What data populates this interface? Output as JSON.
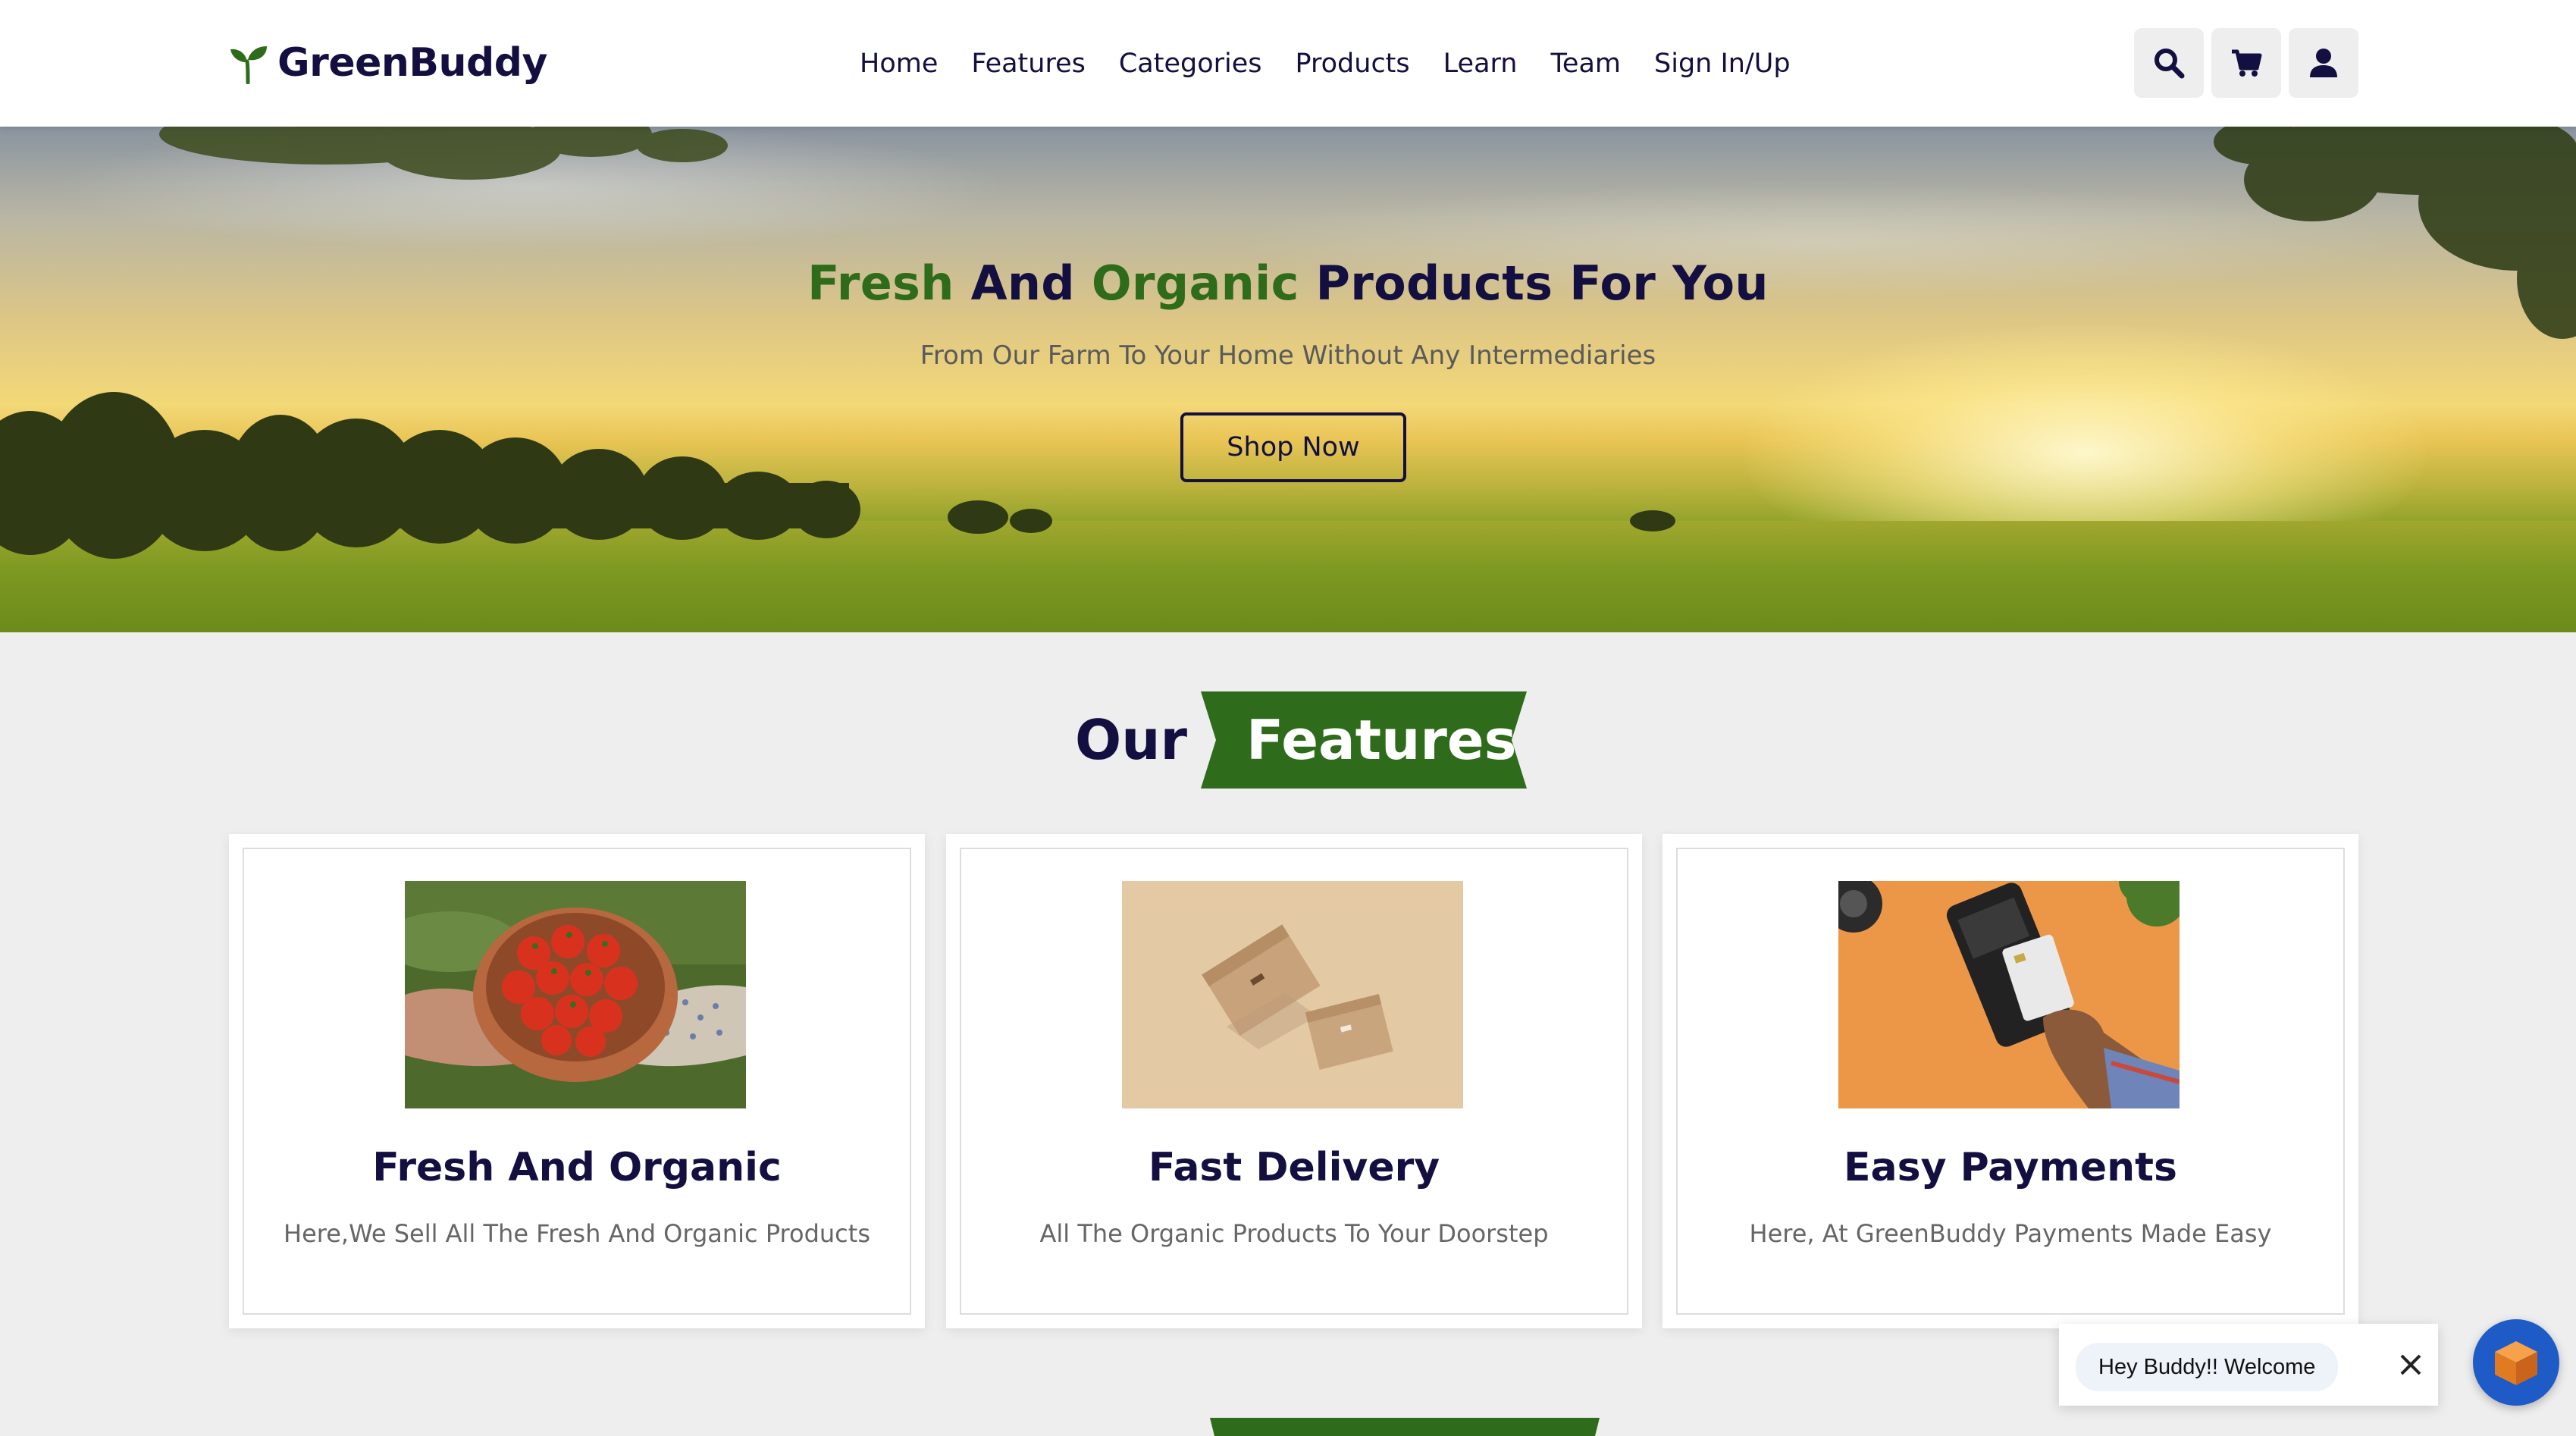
{
  "brand": {
    "name": "GreenBuddy",
    "logo_icon": "sprout-icon",
    "accent": "#2e6b1a",
    "text": "#130f40"
  },
  "nav": {
    "items": [
      "Home",
      "Features",
      "Categories",
      "Products",
      "Learn",
      "Team",
      "Sign In/Up"
    ]
  },
  "header_icons": [
    "search-icon",
    "cart-icon",
    "user-icon"
  ],
  "hero": {
    "title_parts": [
      "Fresh",
      " And ",
      "Organic",
      " Products For You"
    ],
    "subtitle": "From Our Farm To Your Home Without Any Intermediaries",
    "button_label": "Shop Now"
  },
  "features": {
    "heading_plain": "Our",
    "heading_ribbon": "Features",
    "cards": [
      {
        "title": "Fresh And Organic",
        "desc": "Here,We Sell All The Fresh And Organic Products",
        "image": "tomatoes-bowl-image"
      },
      {
        "title": "Fast Delivery",
        "desc": "All The Organic Products To Your Doorstep",
        "image": "delivery-boxes-image"
      },
      {
        "title": "Easy Payments",
        "desc": "Here, At GreenBuddy Payments Made Easy",
        "image": "card-payment-image"
      }
    ]
  },
  "chat": {
    "message": "Hey Buddy!! Welcome",
    "launcher_color": "#1e5bc6"
  }
}
